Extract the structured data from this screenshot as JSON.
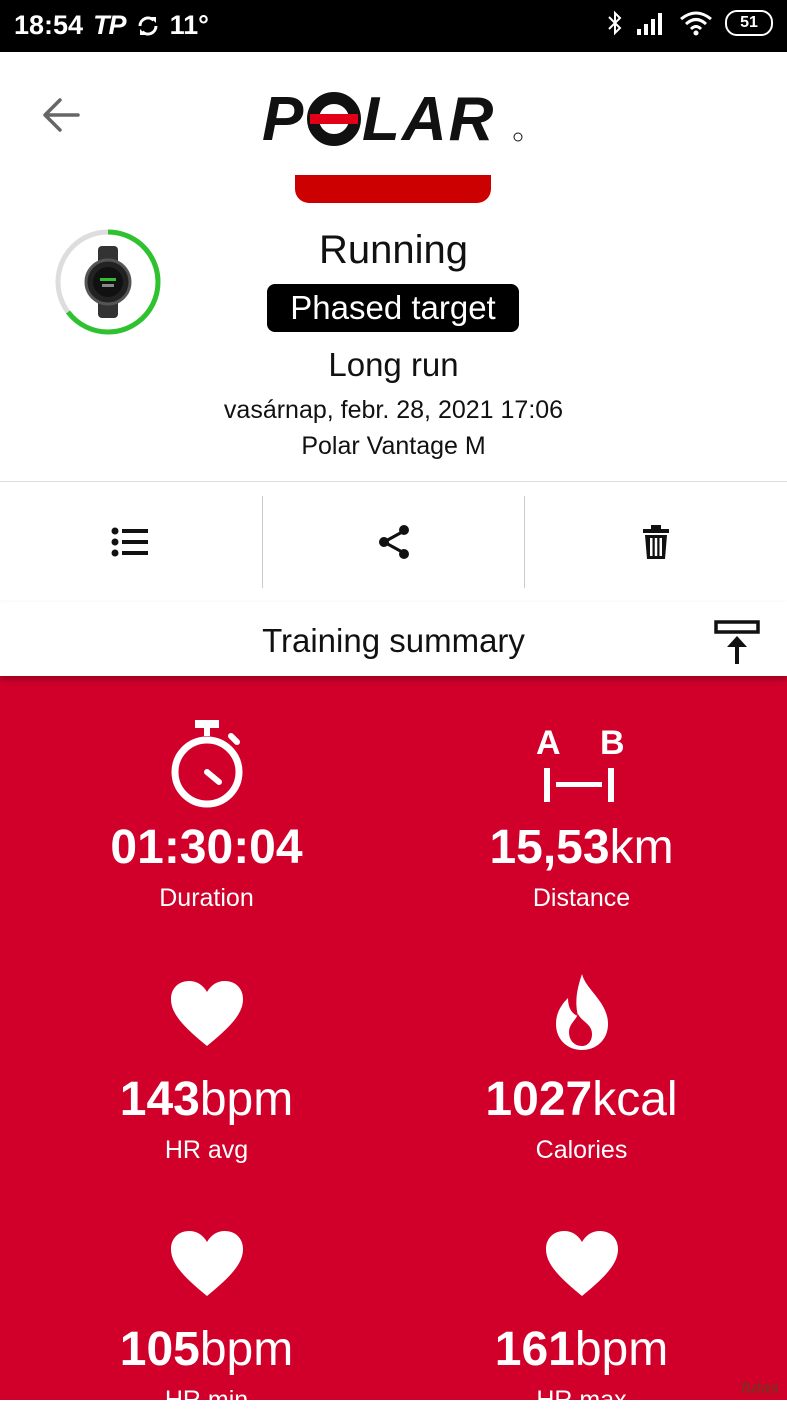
{
  "status_bar": {
    "time": "18:54",
    "carrier": "TP",
    "temperature": "11°",
    "battery": "51"
  },
  "app": {
    "brand": "POLAR",
    "accent_color": "#d1002a"
  },
  "session": {
    "sport": "Running",
    "target_badge": "Phased target",
    "target_name": "Long run",
    "datetime": "vasárnap, febr. 28, 2021 17:06",
    "device": "Polar Vantage M"
  },
  "actions": [
    {
      "name": "list",
      "icon": "list-icon"
    },
    {
      "name": "share",
      "icon": "share-icon"
    },
    {
      "name": "delete",
      "icon": "trash-icon"
    }
  ],
  "summary": {
    "title": "Training summary",
    "metrics": [
      {
        "value": "01:30:04",
        "unit": "",
        "label": "Duration",
        "icon": "stopwatch-icon"
      },
      {
        "value": "15,53",
        "unit": "km",
        "label": "Distance",
        "icon": "distance-ab-icon"
      },
      {
        "value": "143",
        "unit": "bpm",
        "label": "HR avg",
        "icon": "heart-icon"
      },
      {
        "value": "1027",
        "unit": "kcal",
        "label": "Calories",
        "icon": "flame-icon"
      },
      {
        "value": "105",
        "unit": "bpm",
        "label": "HR min",
        "icon": "heart-icon"
      },
      {
        "value": "161",
        "unit": "bpm",
        "label": "HR max",
        "icon": "heart-icon"
      }
    ]
  },
  "watermark": "futas"
}
